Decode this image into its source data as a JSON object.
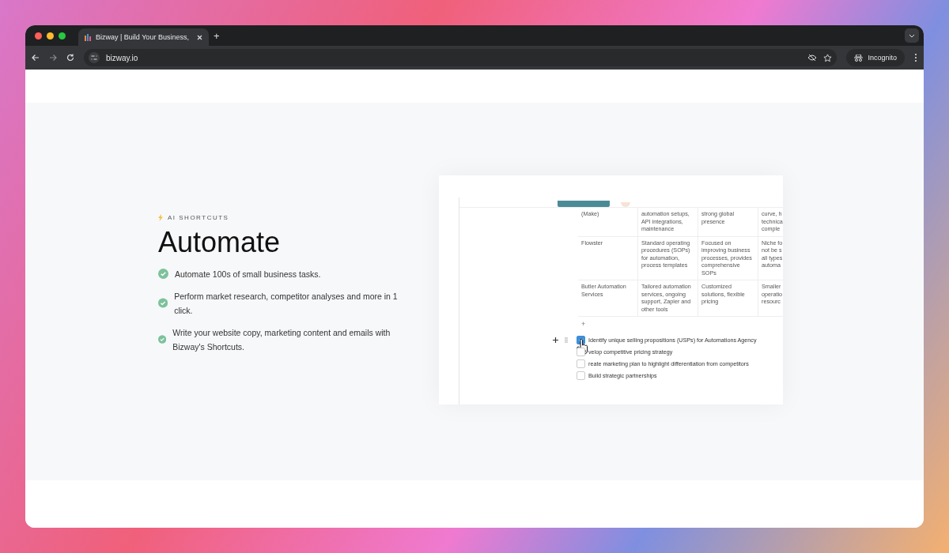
{
  "browser": {
    "tab": {
      "title": "Bizway | Build Your Business,"
    },
    "new_tab": "+",
    "address": "bizway.io",
    "incognito": "Incognito"
  },
  "section": {
    "eyebrow": "AI SHORTCUTS",
    "heading": "Automate",
    "bullets": [
      "Automate 100s of small business tasks.",
      "Perform market research, competitor analyses and more in 1 click.",
      "Write your website copy, marketing content and emails with Bizway's Shortcuts."
    ]
  },
  "preview": {
    "table": {
      "rows": [
        [
          "(Make)",
          "automation setups, API integrations, maintenance",
          "strong global presence",
          "curve, h\ntechnica\ncomple"
        ],
        [
          "Flowster",
          "Standard operating procedures (SOPs) for automation, process templates",
          "Focused on improving business processes, provides comprehensive SOPs",
          "Niche fo\nnot be s\nall types\nautoma"
        ],
        [
          "Butler Automation Services",
          "Tailored automation services, ongoing support, Zapier and other tools",
          "Customized solutions, flexible pricing",
          "Smaller\noperatio\nresourc"
        ]
      ]
    },
    "add_row": "+",
    "tasks": [
      {
        "text": "Identify unique selling propositions (USPs) for Automations Agency",
        "checked": true
      },
      {
        "text": "velop competitive pricing strategy",
        "checked": false
      },
      {
        "text": "reate marketing plan to highlight differentiation from competitors",
        "checked": false
      },
      {
        "text": "Build strategic partnerships",
        "checked": false
      }
    ]
  }
}
